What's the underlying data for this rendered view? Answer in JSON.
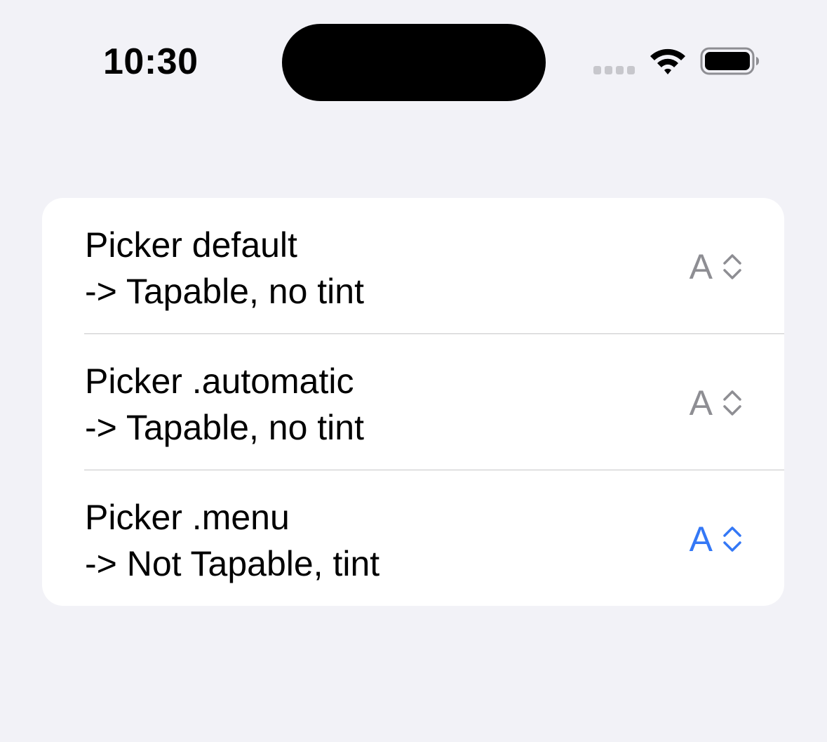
{
  "status_bar": {
    "time": "10:30"
  },
  "rows": [
    {
      "title": "Picker default",
      "subtitle": "-> Tapable, no tint",
      "picker_value": "A",
      "picker_color": "#8e8e93"
    },
    {
      "title": "Picker .automatic",
      "subtitle": "-> Tapable, no tint",
      "picker_value": "A",
      "picker_color": "#8e8e93"
    },
    {
      "title": "Picker .menu",
      "subtitle": "-> Not Tapable, tint",
      "picker_value": "A",
      "picker_color": "#3478f6"
    }
  ],
  "icons": {
    "picker": "chevron-up-down-icon",
    "wifi": "wifi-icon",
    "battery": "battery-icon",
    "signal": "cellular-signal-icon"
  }
}
